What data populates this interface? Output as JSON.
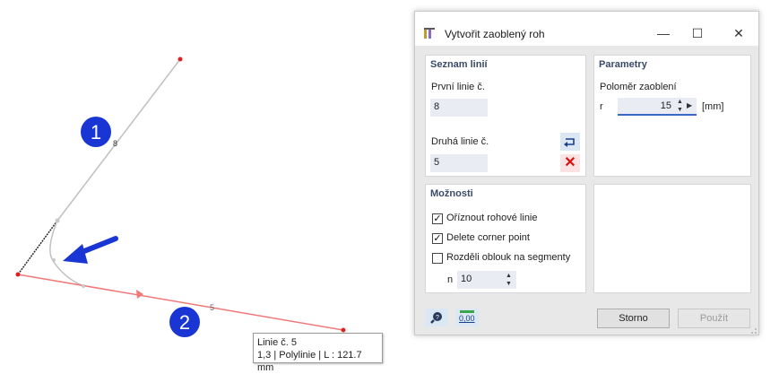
{
  "canvas": {
    "markers": [
      "1",
      "2"
    ],
    "line_labels": [
      "8",
      "5"
    ],
    "colors": {
      "marker_blue": "#1936d4",
      "line2_red": "#f07878",
      "line1_gray": "#c0c0c0",
      "arrow_blue": "#1936d4"
    }
  },
  "tooltip": {
    "line1": "Linie  č.  5",
    "line2": "1,3 | Polylinie | L : 121.7 mm"
  },
  "dialog": {
    "title": "Vytvořit zaoblený roh",
    "window_buttons": {
      "minimize": "—",
      "maximize": "☐",
      "close": "✕"
    },
    "lines_panel": {
      "header": "Seznam linií",
      "first_label": "První linie č.",
      "first_value": "8",
      "second_label": "Druhá linie č.",
      "second_value": "5",
      "reverse_icon": "swap-icon",
      "delete_icon": "delete-icon"
    },
    "params_panel": {
      "header": "Parametry",
      "radius_label": "Poloměr zaoblení",
      "r_label": "r",
      "r_value": "15",
      "unit": "[mm]"
    },
    "options_panel": {
      "header": "Možnosti",
      "options": [
        {
          "label": "Oříznout rohové linie",
          "checked": true
        },
        {
          "label": "Delete corner point",
          "checked": true
        },
        {
          "label": "Rozděli oblouk na segmenty",
          "checked": false
        }
      ],
      "n_label": "n",
      "n_value": "10"
    },
    "footer": {
      "cancel": "Storno",
      "apply": "Použít",
      "units_icon_text": "0,00"
    }
  }
}
